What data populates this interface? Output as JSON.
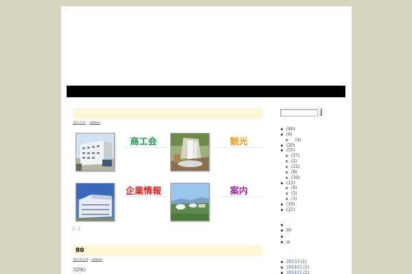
{
  "post1": {
    "title": "",
    "date": "201111",
    "sep": " : ",
    "author": "admin",
    "pager": "[...]",
    "tiles": [
      {
        "label": "商工会",
        "color": "#1a9a4a"
      },
      {
        "label": "観光",
        "color": "#e6a21a"
      },
      {
        "label": "企業情報",
        "color": "#e02020"
      },
      {
        "label": "案内",
        "color": "#a02aa0"
      }
    ]
  },
  "post2": {
    "title": "80",
    "date": "2015329",
    "sep": " : ",
    "author": "admin",
    "excerpt": "329()"
  },
  "sidebar": {
    "categories": [
      {
        "text": "(46)",
        "level": 0
      },
      {
        "text": "(6)",
        "level": 0
      },
      {
        "text": "(4)",
        "level": 1
      },
      {
        "text": "(20)",
        "level": 0
      },
      {
        "text": "(55)",
        "level": 0
      },
      {
        "text": "(17)",
        "level": 1
      },
      {
        "text": "(2)",
        "level": 1
      },
      {
        "text": "(12)",
        "level": 1
      },
      {
        "text": "(8)",
        "level": 1
      },
      {
        "text": "(16)",
        "level": 1
      },
      {
        "text": "(12)",
        "level": 0
      },
      {
        "text": "(6)",
        "level": 1
      },
      {
        "text": "(5)",
        "level": 1
      },
      {
        "text": "(1)",
        "level": 1
      },
      {
        "text": "(19)",
        "level": 0
      },
      {
        "text": "(21)",
        "level": 0
      }
    ],
    "links": [
      "",
      "80",
      "",
      "in"
    ],
    "archives": [
      {
        "link": "20153",
        "count": " (1)"
      },
      {
        "link": "201412",
        "count": " (1)"
      },
      {
        "link": "201411",
        "count": " (2)"
      }
    ]
  }
}
